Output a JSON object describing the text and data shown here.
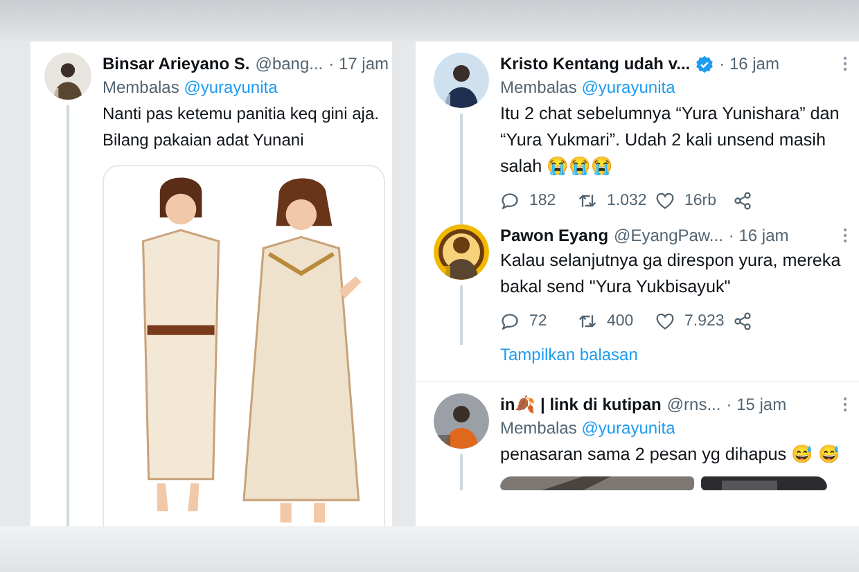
{
  "panels": [
    {
      "tweets": [
        {
          "name": "Binsar Arieyano S.",
          "handle": "@bang...",
          "time": "· 17 jam",
          "replying_prefix": "Membalas",
          "replying_to": "@yurayunita",
          "text": "Nanti pas ketemu panitia keq gini aja. Bilang pakaian adat Yunani"
        }
      ]
    },
    {
      "tweets": [
        {
          "name": "Kristo Kentang udah v...",
          "verified": true,
          "time": "· 16 jam",
          "replying_prefix": "Membalas",
          "replying_to": "@yurayunita",
          "text": "Itu 2 chat sebelumnya “Yura Yunishara” dan “Yura Yukmari”. Udah 2 kali unsend masih salah 😭😭😭",
          "stats": [
            {
              "kind": "reply",
              "count": "182"
            },
            {
              "kind": "retweet",
              "count": "1.032"
            },
            {
              "kind": "like",
              "count": "16rb"
            },
            {
              "kind": "share"
            }
          ]
        },
        {
          "name": "Pawon Eyang",
          "handle": "@EyangPaw...",
          "time": "· 16 jam",
          "text": "Kalau selanjutnya ga direspon yura, mereka bakal send \"Yura Yukbisayuk\"",
          "stats": [
            {
              "kind": "reply",
              "count": "72"
            },
            {
              "kind": "retweet",
              "count": "400"
            },
            {
              "kind": "like",
              "count": "7.923"
            },
            {
              "kind": "share"
            }
          ],
          "show_replies": "Tampilkan balasan"
        },
        {
          "name": "in🍂 | link di kutipan",
          "handle": "@rns...",
          "time": "· 15 jam",
          "replying_prefix": "Membalas",
          "replying_to": "@yurayunita",
          "text": "penasaran sama 2 pesan yg dihapus 😅 😅"
        }
      ]
    }
  ]
}
